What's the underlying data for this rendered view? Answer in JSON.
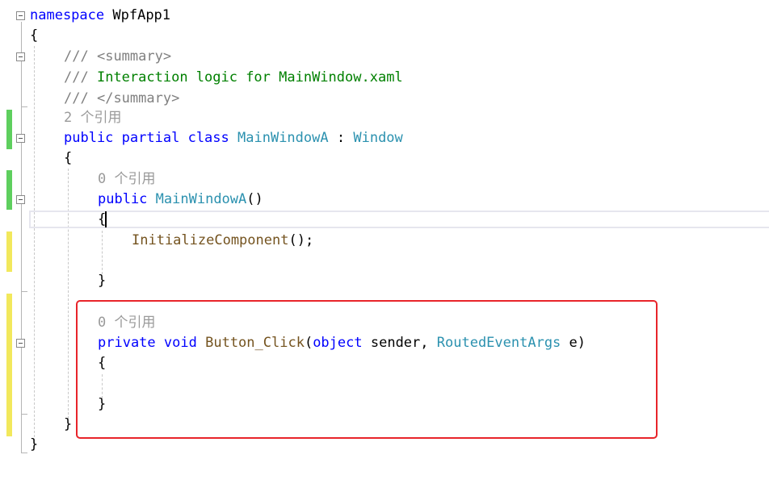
{
  "code": {
    "ns_keyword": "namespace",
    "ns_name": "WpfApp1",
    "brace_open": "{",
    "brace_close": "}",
    "doc_prefix": "///",
    "summary_open": "<summary>",
    "summary_text": "Interaction logic for MainWindow.xaml",
    "summary_close": "</summary>",
    "class_refs": "2 个引用",
    "kw_public": "public",
    "kw_partial": "partial",
    "kw_class": "class",
    "class_name": "MainWindowA",
    "colon": ":",
    "base_class": "Window",
    "ctor_refs": "0 个引用",
    "ctor_name": "MainWindowA",
    "parens": "()",
    "init_call": "InitializeComponent",
    "call_tail": "();",
    "handler_refs": "0 个引用",
    "kw_private": "private",
    "kw_void": "void",
    "method_name": "Button_Click",
    "paren_open": "(",
    "kw_object": "object",
    "param_sender": "sender,",
    "param_type": "RoutedEventArgs",
    "param_e": "e",
    "paren_close": ")"
  },
  "colors": {
    "keyword": "#0000ff",
    "type": "#2b91af",
    "comment": "#008000",
    "annotation_box": "#e8242a",
    "saved_change": "#5ecf5e",
    "unsaved_change": "#f2e85c"
  }
}
